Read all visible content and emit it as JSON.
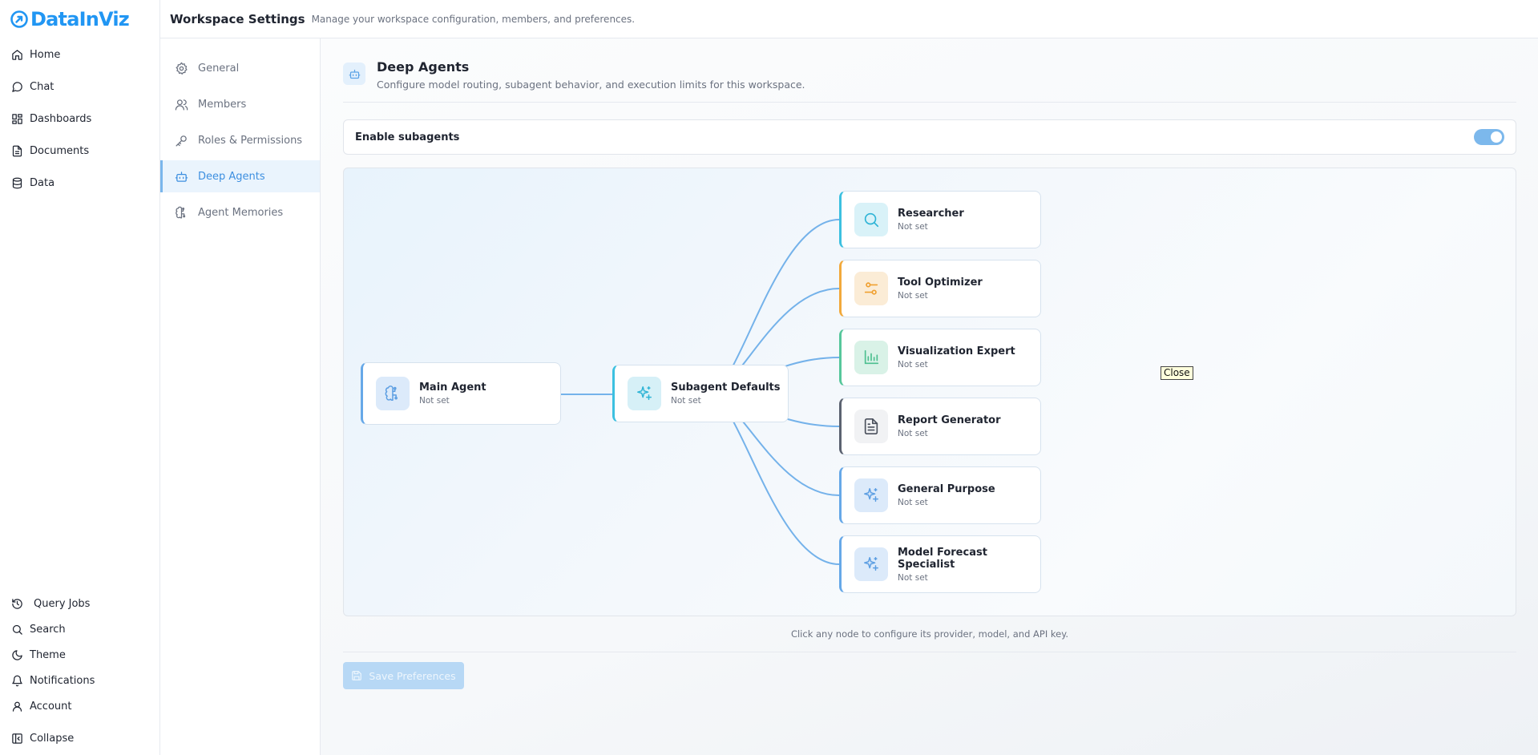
{
  "app": {
    "logo_text": "DataInViz",
    "nav": [
      {
        "label": "Home",
        "icon": "home-icon"
      },
      {
        "label": "Chat",
        "icon": "chat-icon"
      },
      {
        "label": "Dashboards",
        "icon": "dashboard-icon"
      },
      {
        "label": "Documents",
        "icon": "document-icon"
      },
      {
        "label": "Data",
        "icon": "database-icon"
      }
    ],
    "bottom_nav": [
      {
        "label": "Query Jobs",
        "icon": "history-icon"
      },
      {
        "label": "Search",
        "icon": "search-icon"
      },
      {
        "label": "Theme",
        "icon": "moon-icon"
      },
      {
        "label": "Notifications",
        "icon": "bell-icon"
      },
      {
        "label": "Account",
        "icon": "user-icon"
      },
      {
        "label": "Collapse",
        "icon": "collapse-icon"
      }
    ]
  },
  "header": {
    "title": "Workspace Settings",
    "subtitle": "Manage your workspace configuration, members, and preferences."
  },
  "settings_nav": {
    "items": [
      {
        "label": "General",
        "icon": "gear-icon"
      },
      {
        "label": "Members",
        "icon": "users-icon"
      },
      {
        "label": "Roles & Permissions",
        "icon": "key-icon"
      },
      {
        "label": "Deep Agents",
        "icon": "robot-icon",
        "active": true
      },
      {
        "label": "Agent Memories",
        "icon": "brain-icon"
      }
    ]
  },
  "section": {
    "title": "Deep Agents",
    "description": "Configure model routing, subagent behavior, and execution limits for this workspace.",
    "icon": "robot-icon"
  },
  "enable_subagents": {
    "label": "Enable subagents",
    "enabled": true
  },
  "graph": {
    "main": {
      "title": "Main Agent",
      "status": "Not set",
      "icon": "brain-icon",
      "accent": "#66a8e8"
    },
    "defaults": {
      "title": "Subagent Defaults",
      "status": "Not set",
      "icon": "sparkles-icon",
      "accent": "#3cc0e0"
    },
    "subagents": [
      {
        "title": "Researcher",
        "status": "Not set",
        "icon": "search-icon",
        "accent": "#3cc0e0",
        "icon_bg": "#d9f2f8",
        "icon_color": "#2eb4d6"
      },
      {
        "title": "Tool Optimizer",
        "status": "Not set",
        "icon": "sliders-icon",
        "accent": "#f2a93b",
        "icon_bg": "#fbecd6",
        "icon_color": "#f0a030"
      },
      {
        "title": "Visualization Expert",
        "status": "Not set",
        "icon": "bar-chart-icon",
        "accent": "#56c79b",
        "icon_bg": "#d9f2e7",
        "icon_color": "#4cbf8f"
      },
      {
        "title": "Report Generator",
        "status": "Not set",
        "icon": "file-text-icon",
        "accent": "#5b6270",
        "icon_bg": "#f1f2f4",
        "icon_color": "#4a505c"
      },
      {
        "title": "General Purpose",
        "status": "Not set",
        "icon": "sparkles-icon",
        "accent": "#66a8e8",
        "icon_bg": "#dceafa",
        "icon_color": "#5a9de2"
      },
      {
        "title": "Model Forecast Specialist",
        "status": "Not set",
        "icon": "sparkles-icon",
        "accent": "#66a8e8",
        "icon_bg": "#dceafa",
        "icon_color": "#5a9de2"
      }
    ]
  },
  "tooltip": "Close",
  "hint": "Click any node to configure its provider, model, and API key.",
  "save_button": "Save Preferences"
}
